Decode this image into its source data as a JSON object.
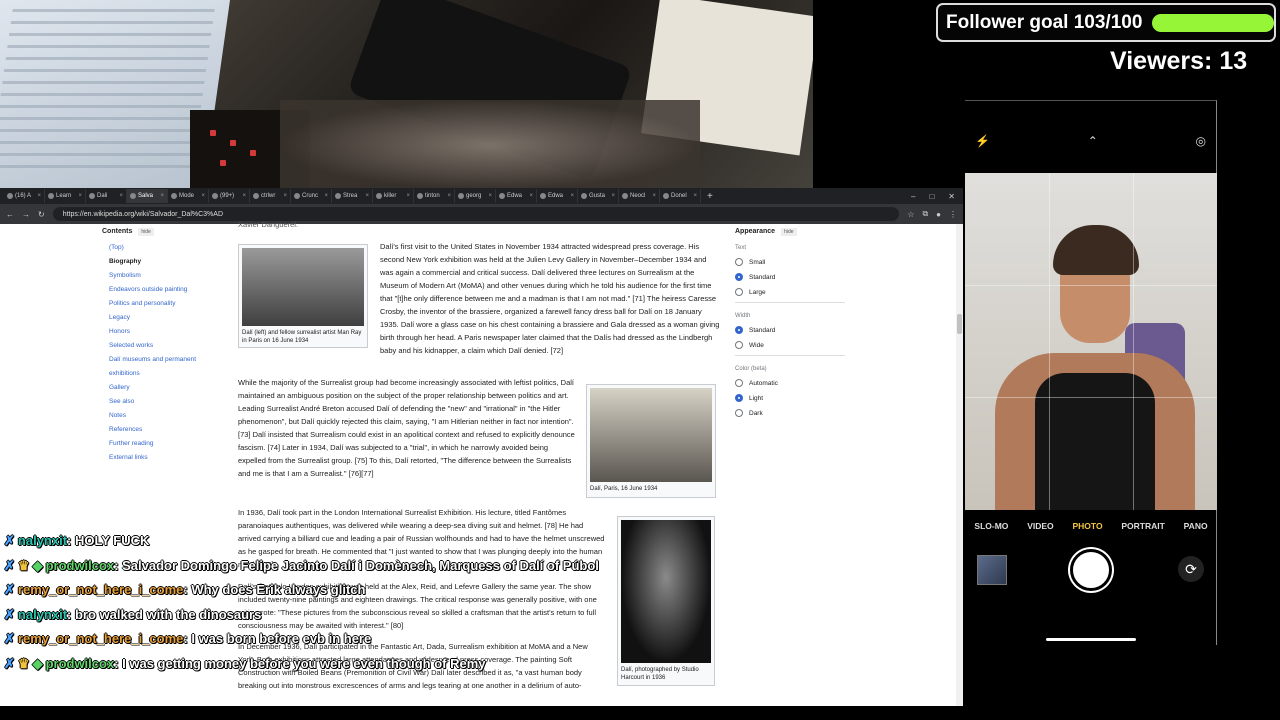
{
  "overlay": {
    "follower_label": "Follower goal 103/100",
    "follower_progress": 1.0,
    "viewers_label": "Viewers: 13",
    "accent_color": "#96f536"
  },
  "browser": {
    "tabs": [
      "(16) A",
      "Learn",
      "Dali",
      "Salva",
      "Mode",
      "(99+)",
      "ctrlwr",
      "Crunc",
      "Strea",
      "killer",
      "tinton",
      "georg",
      "Edwa",
      "Edwa",
      "Gusta",
      "Neocl",
      "Donel"
    ],
    "active_tab_index": 3,
    "url": "https://en.wikipedia.org/wiki/Salvador_Dal%C3%AD"
  },
  "wiki": {
    "toc": {
      "title": "Contents",
      "hide": "hide",
      "items": [
        "(Top)",
        "Biography",
        "Symbolism",
        "Endeavors outside painting",
        "Politics and personality",
        "Legacy",
        "Honors",
        "Selected works",
        "Dalí museums and permanent exhibitions",
        "Gallery",
        "See also",
        "Notes",
        "References",
        "Further reading",
        "External links"
      ]
    },
    "appearance": {
      "title": "Appearance",
      "hide": "hide",
      "text_label": "Text",
      "text_options": [
        "Small",
        "Standard",
        "Large"
      ],
      "width_label": "Width",
      "width_options": [
        "Standard",
        "Wide"
      ],
      "color_label": "Color (beta)",
      "color_options": [
        "Automatic",
        "Light",
        "Dark"
      ]
    },
    "top_fragment": "Xavier Dangüerel.",
    "p1": "Dalí's first visit to the United States in November 1934 attracted widespread press coverage. His second New York exhibition was held at the Julien Levy Gallery in November–December 1934 and was again a commercial and critical success. Dalí delivered three lectures on Surrealism at the Museum of Modern Art (MoMA) and other venues during which he told his audience for the first time that \"[t]he only difference between me and a madman is that I am not mad.\" [71] The heiress Caresse Crosby, the inventor of the brassiere, organized a farewell fancy dress ball for Dalí on 18 January 1935. Dalí wore a glass case on his chest containing a brassiere and Gala dressed as a woman giving birth through her head. A Paris newspaper later claimed that the Dalís had dressed as the Lindbergh baby and his kidnapper, a claim which Dalí denied. [72]",
    "p2": "While the majority of the Surrealist group had become increasingly associated with leftist politics, Dalí maintained an ambiguous position on the subject of the proper relationship between politics and art. Leading Surrealist André Breton accused Dalí of defending the \"new\" and \"irrational\" in \"the Hitler phenomenon\", but Dalí quickly rejected this claim, saying, \"I am Hitlerian neither in fact nor intention\". [73] Dalí insisted that Surrealism could exist in an apolitical context and refused to explicitly denounce fascism. [74] Later in 1934, Dalí was subjected to a \"trial\", in which he narrowly avoided being expelled from the Surrealist group. [75] To this, Dalí retorted, \"The difference between the Surrealists and me is that I am a Surrealist.\" [76][77]",
    "p3": "In 1936, Dalí took part in the London International Surrealist Exhibition. His lecture, titled Fantômes paranoiaques authentiques, was delivered while wearing a deep-sea diving suit and helmet. [78] He had arrived carrying a billiard cue and leading a pair of Russian wolfhounds and had to have the helmet unscrewed as he gasped for breath. He commented that \"I just wanted to show that I was plunging deeply into the human mind.\" [79]",
    "p4": "Dalí's first solo London exhibition was held at the Alex, Reid, and Lefevre Gallery the same year. The show included twenty-nine paintings and eighteen drawings. The critical response was generally positive, with one critic wrote: \"These pictures from the subconscious reveal so skilled a craftsman that the artist's return to full consciousness may be awaited with interest.\" [80]",
    "p5": "In December 1936, Dalí participated in the Fantastic Art, Dada, Surrealism exhibition at MoMA and a New York. Both exhibitions attracted large attendances and widespread press coverage. The painting Soft Construction with Boiled Beans (Premonition of Civil War) Dalí later described it as, \"a vast human body breaking out into monstrous excrescences of arms and legs tearing at one another in a delirium of auto-",
    "fig1_caption": "Dalí (left) and fellow surrealist artist Man Ray in Paris on 16 June 1934",
    "fig2_caption": "Dalí, Paris, 16 June 1934",
    "fig3_caption": "Dalí, photographed by Studio Harcourt in 1936"
  },
  "chat": [
    {
      "user": "nalynxit",
      "text": "HOLY FUCK",
      "badges": ""
    },
    {
      "user": "prodwilcox",
      "text": "Salvador Domingo Felipe Jacinto Dalí i Domènech, Marquess of Dalí of Púbol",
      "badges": "crown-gem"
    },
    {
      "user": "remy_or_not_here_i_come",
      "text": "Why does Erik always glitch",
      "badges": ""
    },
    {
      "user": "nalynxit",
      "text": "bro walked with the dinosaurs",
      "badges": ""
    },
    {
      "user": "remy_or_not_here_i_come",
      "text": "I was born before evb in here",
      "badges": ""
    },
    {
      "user": "prodwilcox",
      "text": "I was getting money before you were even though of Remy",
      "badges": "crown-gem"
    }
  ],
  "camera": {
    "modes": [
      "SLO-MO",
      "VIDEO",
      "PHOTO",
      "PORTRAIT",
      "PANO"
    ],
    "active_mode": "PHOTO"
  }
}
